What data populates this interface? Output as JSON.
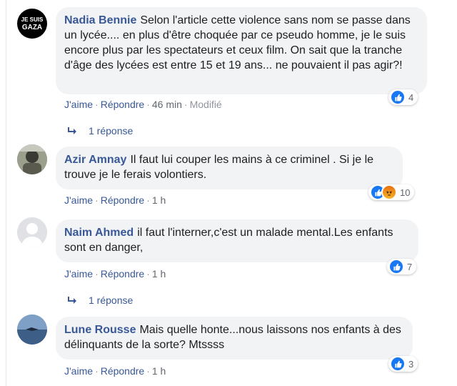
{
  "comments": [
    {
      "author": "Nadia Bennie",
      "text": "Selon l'article cette violence sans nom se passe dans un lycée.... en plus d'être choquée par ce pseudo homme, je le suis encore plus par les spectateurs et ceux film. On sait que la tranche d'âge des lycées est entre 15 et 19 ans... ne pouvaient il pas agir?!",
      "like": "J'aime",
      "reply": "Répondre",
      "time": "46 min",
      "modified": "Modifié",
      "reaction_count": "4",
      "reactions": [
        "like-icon"
      ],
      "avatar_text": "JE SUIS GAZA",
      "replies_label": "1 réponse"
    },
    {
      "author": "Azir Amnay",
      "text": "Il faut lui couper les mains à ce criminel . Si je le trouve je le ferais volontiers.",
      "like": "J'aime",
      "reply": "Répondre",
      "time": "1 h",
      "reaction_count": "10",
      "reactions": [
        "like-icon",
        "angry-icon"
      ]
    },
    {
      "author": "Naim Ahmed",
      "text": "il faut l'interner,c'est un malade mental.Les enfants sont en danger,",
      "like": "J'aime",
      "reply": "Répondre",
      "time": "1 h",
      "reaction_count": "7",
      "reactions": [
        "like-icon"
      ],
      "replies_label": "1 réponse"
    },
    {
      "author": "Lune Rousse",
      "text": "Mais quelle honte...nous laissons nos enfants à des délinquants de la sorte? Mtssss",
      "like": "J'aime",
      "reply": "Répondre",
      "time": "1 h",
      "reaction_count": "3",
      "reactions": [
        "like-icon"
      ]
    }
  ],
  "colors": {
    "author": "#385898",
    "bubble": "#f2f3f5",
    "like_blue": "#1877f2"
  }
}
